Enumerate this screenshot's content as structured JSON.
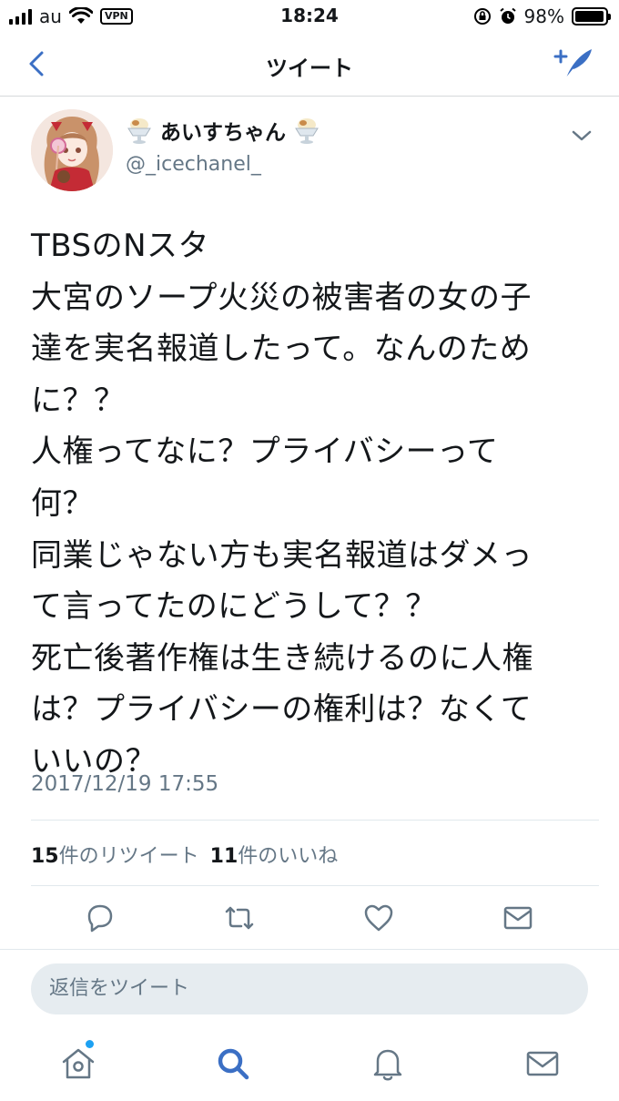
{
  "status_bar": {
    "carrier": "au",
    "vpn": "VPN",
    "time": "18:24",
    "battery_text": "98%",
    "battery_level": 0.98
  },
  "nav": {
    "title": "ツイート",
    "back_icon": "chevron-left-icon",
    "compose_icon": "compose-tweet-icon"
  },
  "tweet": {
    "display_name": "あいすちゃん",
    "handle": "@_icechanel_",
    "text_lines": [
      "TBSのNスタ",
      "大宮のソープ火災の被害者の女の子",
      "達を実名報道したって。なんのため",
      "に？？",
      "人権ってなに？プライバシーって",
      "何？",
      "同業じゃない方も実名報道はダメっ",
      "て言ってたのにどうして？？",
      "死亡後著作権は生き続けるのに人権",
      "は？プライバシーの権利は？なくて",
      "いいの？"
    ],
    "timestamp": "2017/12/19 17:55",
    "retweet_count": "15",
    "retweet_label": "件のリツイート",
    "like_count": "11",
    "like_label": "件のいいね"
  },
  "reply": {
    "placeholder": "返信をツイート"
  },
  "colors": {
    "accent": "#1da1f2",
    "nav_blue": "#3b6fc4",
    "secondary_text": "#657786",
    "icon_gray": "#657786"
  }
}
